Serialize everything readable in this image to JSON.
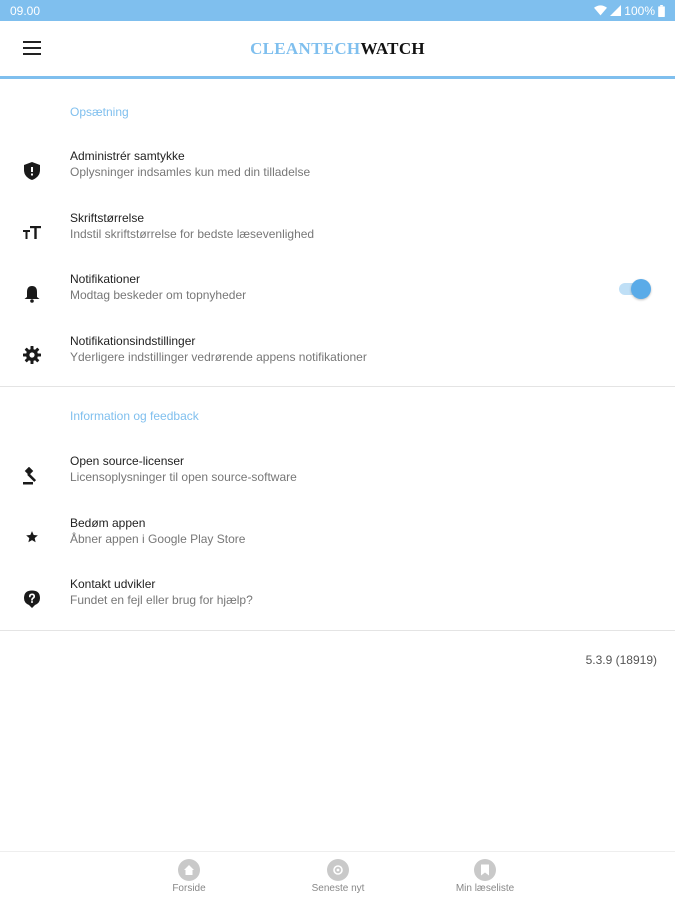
{
  "status_bar": {
    "time": "09.00",
    "battery": "100%"
  },
  "app_bar": {
    "logo_part1": "CLEANTECH",
    "logo_part2": "WATCH"
  },
  "sections": [
    {
      "header": "Opsætning",
      "items": [
        {
          "icon": "shield-icon",
          "title": "Administrér samtykke",
          "subtitle": "Oplysninger indsamles kun med din tilladelse"
        },
        {
          "icon": "font-size-icon",
          "title": "Skriftstørrelse",
          "subtitle": "Indstil skriftstørrelse for bedste læsevenlighed"
        },
        {
          "icon": "bell-icon",
          "title": "Notifikationer",
          "subtitle": "Modtag beskeder om topnyheder",
          "toggle_on": true
        },
        {
          "icon": "gear-icon",
          "title": "Notifikationsindstillinger",
          "subtitle": "Yderligere indstillinger vedrørende appens notifikationer"
        }
      ]
    },
    {
      "header": "Information og feedback",
      "items": [
        {
          "icon": "gavel-icon",
          "title": "Open source-licenser",
          "subtitle": "Licensoplysninger til open source-software"
        },
        {
          "icon": "star-icon",
          "title": "Bedøm appen",
          "subtitle": "Åbner appen i Google Play Store"
        },
        {
          "icon": "help-icon",
          "title": "Kontakt udvikler",
          "subtitle": "Fundet en fejl eller brug for hjælp?"
        }
      ]
    }
  ],
  "version": "5.3.9 (18919)",
  "bottom_nav": [
    {
      "icon": "home-icon",
      "label": "Forside"
    },
    {
      "icon": "latest-news-icon",
      "label": "Seneste nyt"
    },
    {
      "icon": "bookmark-icon",
      "label": "Min læseliste"
    }
  ],
  "colors": {
    "accent": "#7fbfee",
    "toggle_thumb": "#5aabe8",
    "nav_icon": "#c9c9c9"
  }
}
